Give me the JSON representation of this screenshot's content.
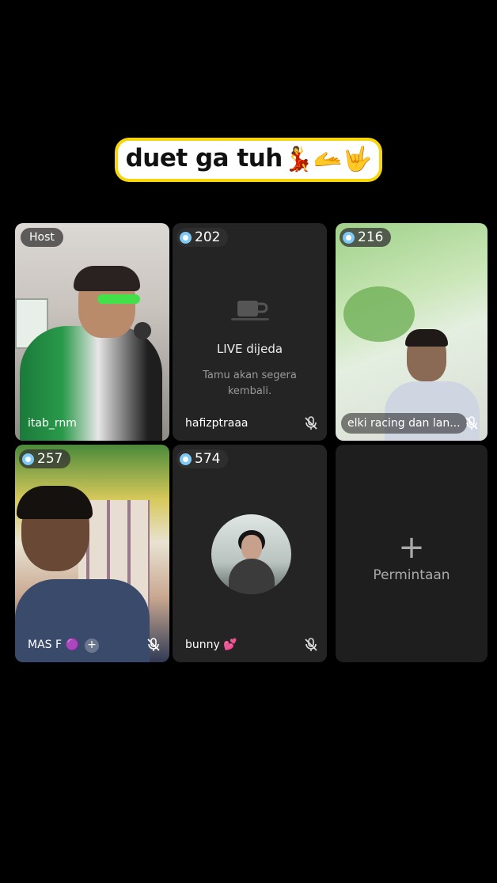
{
  "caption": {
    "text": "duet ga tuh",
    "emoji": "💃🫴🤟"
  },
  "tiles": [
    {
      "badge": "Host",
      "name": "itab_rnm"
    },
    {
      "viewers": "202",
      "status_title": "LIVE dijeda",
      "status_sub": "Tamu akan segera kembali.",
      "name": "hafizptraaa",
      "icon": "mic-off-icon"
    },
    {
      "viewers": "216",
      "name": "elki racing dan lan...",
      "icon": "mic-off-icon"
    },
    {
      "viewers": "257",
      "name": "MAS F 🟣",
      "icon": "mic-off-icon"
    },
    {
      "viewers": "574",
      "name": "bunny 💕",
      "icon": "mic-off-icon"
    },
    {
      "plus": "+",
      "label": "Permintaan"
    }
  ]
}
